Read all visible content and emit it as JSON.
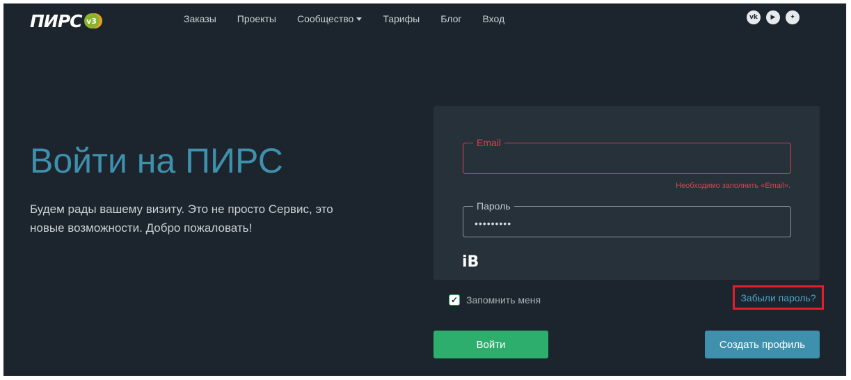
{
  "logo": {
    "text": "ПИРС",
    "badge": "v3"
  },
  "nav": {
    "items": [
      "Заказы",
      "Проекты",
      "Сообщество",
      "Тарифы",
      "Блог",
      "Вход"
    ]
  },
  "socials": {
    "icons": [
      "vk-icon",
      "youtube-icon",
      "zen-icon"
    ],
    "labels": [
      "vk",
      "▶",
      "✦"
    ]
  },
  "hero": {
    "title": "Войти на ПИРС",
    "subtitle": "Будем рады вашему визиту. Это не просто Сервис, это новые возможности. Добро пожаловать!"
  },
  "form": {
    "email_label": "Email",
    "email_value": "",
    "email_error": "Необходимо заполнить «Email».",
    "password_label": "Пароль",
    "password_value": "•••••••••",
    "captcha_logo": "iB",
    "remember_label": "Запомнить меня",
    "remember_checked": true,
    "forgot_label": "Забыли пароль?",
    "login_button": "Войти",
    "register_button": "Создать профиль"
  },
  "colors": {
    "background": "#1c252d",
    "panel": "#27313a",
    "accent_blue": "#3f90ad",
    "accent_green": "#2dae6c",
    "error": "#d8424f",
    "highlight": "#e3202a"
  }
}
